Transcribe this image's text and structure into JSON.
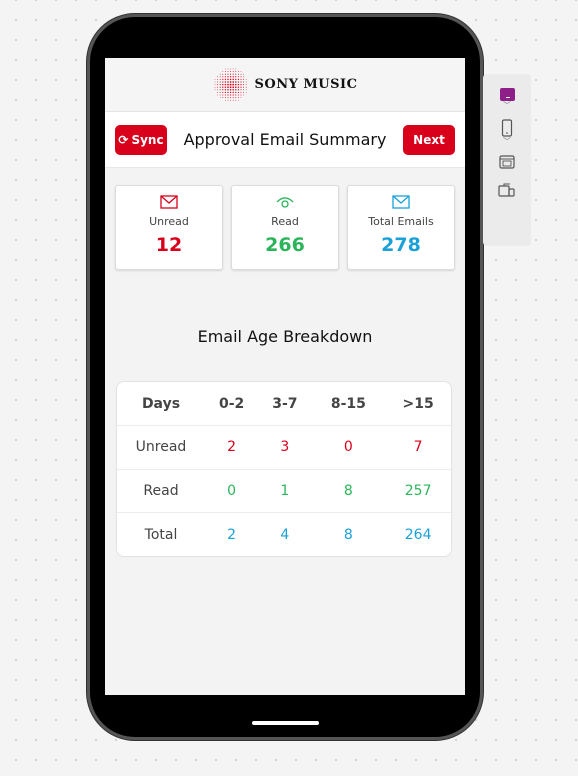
{
  "brand": {
    "name": "SONY MUSIC"
  },
  "header": {
    "sync_label": "Sync",
    "title": "Approval Email Summary",
    "next_label": "Next"
  },
  "summary_cards": [
    {
      "label": "Unread",
      "value": "12",
      "icon": "mail-icon",
      "color": "#d9001b"
    },
    {
      "label": "Read",
      "value": "266",
      "icon": "eye-icon",
      "color": "#2bb55a"
    },
    {
      "label": "Total Emails",
      "value": "278",
      "icon": "mail-icon",
      "color": "#1aa1d8"
    }
  ],
  "breakdown": {
    "title": "Email Age Breakdown",
    "columns": [
      "Days",
      "0-2",
      "3-7",
      "8-15",
      ">15"
    ],
    "rows": [
      {
        "label": "Unread",
        "values": [
          "2",
          "3",
          "0",
          "7"
        ],
        "color": "#d9001b"
      },
      {
        "label": "Read",
        "values": [
          "0",
          "1",
          "8",
          "257"
        ],
        "color": "#2bb55a"
      },
      {
        "label": "Total",
        "values": [
          "2",
          "4",
          "8",
          "264"
        ],
        "color": "#1aa1d8"
      }
    ]
  },
  "toolbar": {
    "items": [
      "color-swatch",
      "phone-device-icon",
      "keyboard-icon",
      "rotate-device-icon"
    ],
    "swatch_color": "#8e1f88"
  }
}
